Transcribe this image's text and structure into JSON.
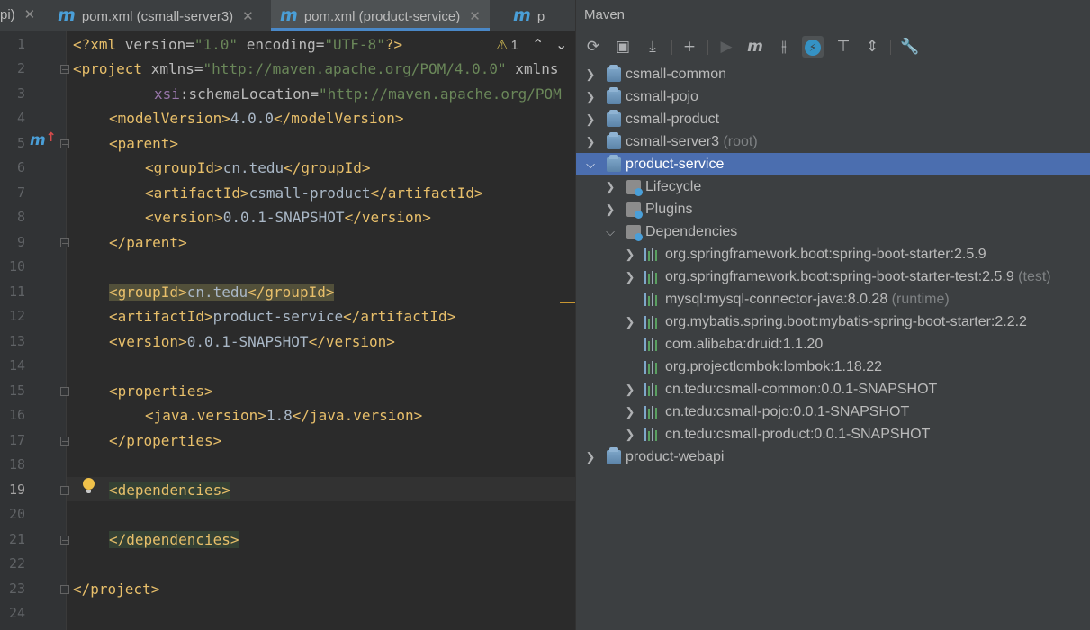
{
  "tabs": [
    {
      "label": "pi)"
    },
    {
      "label": "pom.xml (csmall-server3)"
    },
    {
      "label": "pom.xml (product-service)"
    },
    {
      "label": "p"
    }
  ],
  "editor": {
    "inspection_count": "1",
    "current_line": 19,
    "line_numbers": [
      "1",
      "2",
      "3",
      "4",
      "5",
      "6",
      "7",
      "8",
      "9",
      "10",
      "11",
      "12",
      "13",
      "14",
      "15",
      "16",
      "17",
      "18",
      "19",
      "20",
      "21",
      "22",
      "23",
      "24"
    ],
    "lines": {
      "l1": {
        "a": "<?xml ",
        "b": "version",
        "c": "=",
        "d": "\"1.0\"",
        "e": " ",
        "f": "encoding",
        "g": "=",
        "h": "\"UTF-8\"",
        "i": "?>"
      },
      "l2": {
        "a": "<project ",
        "b": "xmlns",
        "c": "=",
        "d": "\"http://maven.apache.org/POM/4.0.0\"",
        "e": " xmlns"
      },
      "l3": {
        "a": "xsi",
        "b": ":schemaLocation",
        "c": "=",
        "d": "\"http://maven.apache.org/POM"
      },
      "l4": {
        "a": "<modelVersion>",
        "b": "4.0.0",
        "c": "</modelVersion>"
      },
      "l5": {
        "a": "<parent>"
      },
      "l6": {
        "a": "<groupId>",
        "b": "cn.tedu",
        "c": "</groupId>"
      },
      "l7": {
        "a": "<artifactId>",
        "b": "csmall-product",
        "c": "</artifactId>"
      },
      "l8": {
        "a": "<version>",
        "b": "0.0.1-SNAPSHOT",
        "c": "</version>"
      },
      "l9": {
        "a": "</parent>"
      },
      "l11": {
        "a": "<groupId>",
        "b": "cn.tedu",
        "c": "</groupId>"
      },
      "l12": {
        "a": "<artifactId>",
        "b": "product-service",
        "c": "</artifactId>"
      },
      "l13": {
        "a": "<version>",
        "b": "0.0.1-SNAPSHOT",
        "c": "</version>"
      },
      "l15": {
        "a": "<properties>"
      },
      "l16": {
        "a": "<java.version>",
        "b": "1.8",
        "c": "</java.version>"
      },
      "l17": {
        "a": "</properties>"
      },
      "l19": {
        "a": "<dependencies>"
      },
      "l21": {
        "a": "</dependencies>"
      },
      "l23": {
        "a": "</project>"
      }
    }
  },
  "maven": {
    "title": "Maven",
    "toolbar_icons": [
      "reload-icon",
      "generate-sources-icon",
      "download-icon",
      "add-icon",
      "run-icon",
      "maven-goal-icon",
      "toggle-offline-icon",
      "skip-tests-icon",
      "show-dependencies-icon",
      "collapse-all-icon",
      "settings-icon"
    ],
    "tree": [
      {
        "label": "csmall-common",
        "sub": ""
      },
      {
        "label": "csmall-pojo",
        "sub": ""
      },
      {
        "label": "csmall-product",
        "sub": ""
      },
      {
        "label": "csmall-server3",
        "sub": " (root)"
      },
      {
        "label": "product-service",
        "sub": ""
      },
      {
        "label": "Lifecycle",
        "sub": ""
      },
      {
        "label": "Plugins",
        "sub": ""
      },
      {
        "label": "Dependencies",
        "sub": ""
      },
      {
        "label": "org.springframework.boot:spring-boot-starter:2.5.9",
        "sub": ""
      },
      {
        "label": "org.springframework.boot:spring-boot-starter-test:2.5.9",
        "sub": " (test)"
      },
      {
        "label": "mysql:mysql-connector-java:8.0.28",
        "sub": " (runtime)"
      },
      {
        "label": "org.mybatis.spring.boot:mybatis-spring-boot-starter:2.2.2",
        "sub": ""
      },
      {
        "label": "com.alibaba:druid:1.1.20",
        "sub": ""
      },
      {
        "label": "org.projectlombok:lombok:1.18.22",
        "sub": ""
      },
      {
        "label": "cn.tedu:csmall-common:0.0.1-SNAPSHOT",
        "sub": ""
      },
      {
        "label": "cn.tedu:csmall-pojo:0.0.1-SNAPSHOT",
        "sub": ""
      },
      {
        "label": "cn.tedu:csmall-product:0.0.1-SNAPSHOT",
        "sub": ""
      },
      {
        "label": "product-webapi",
        "sub": ""
      }
    ]
  }
}
